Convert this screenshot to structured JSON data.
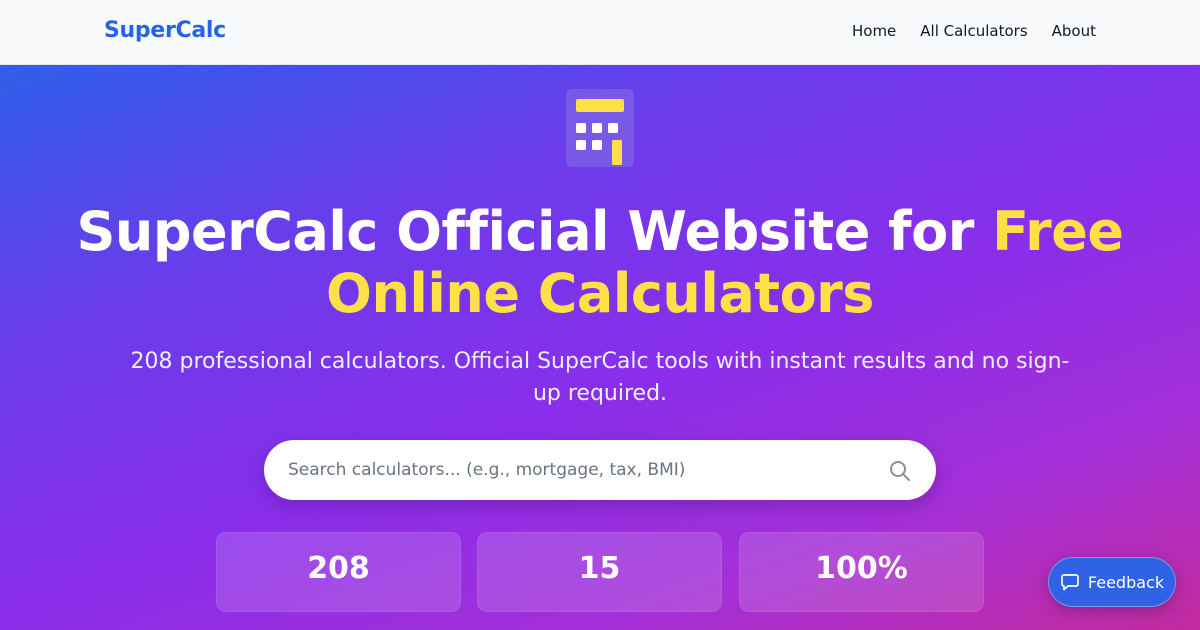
{
  "header": {
    "logo": "SuperCalc",
    "nav": [
      "Home",
      "All Calculators",
      "About"
    ]
  },
  "hero": {
    "icon": "calculator-icon",
    "title_part1": "SuperCalc Official Website for ",
    "title_highlight": "Free Online Calculators",
    "subtitle": "208 professional calculators. Official SuperCalc tools with instant results and no sign-up required.",
    "search_placeholder": "Search calculators... (e.g., mortgage, tax, BMI)",
    "search_value": ""
  },
  "stats": [
    "208",
    "15",
    "100%"
  ],
  "feedback": {
    "label": "Feedback",
    "icon": "chat-bubble-icon"
  },
  "colors": {
    "brand": "#2563eb",
    "highlight": "#fde047",
    "feedback": "#2f62e4"
  }
}
